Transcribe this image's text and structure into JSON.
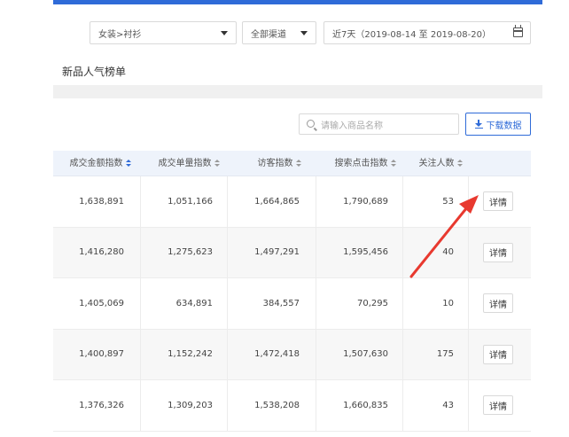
{
  "filters": {
    "category": "女装>衬衫",
    "channel": "全部渠道",
    "date_range": "近7天（2019-08-14 至 2019-08-20）"
  },
  "section_title": "新品人气榜单",
  "search": {
    "placeholder": "请输入商品名称"
  },
  "download_label": "下载数据",
  "table": {
    "headers": [
      "成交金额指数",
      "成交单量指数",
      "访客指数",
      "搜索点击指数",
      "关注人数"
    ],
    "rows": [
      [
        "1,638,891",
        "1,051,166",
        "1,664,865",
        "1,790,689",
        "53"
      ],
      [
        "1,416,280",
        "1,275,623",
        "1,497,291",
        "1,595,456",
        "40"
      ],
      [
        "1,405,069",
        "634,891",
        "384,557",
        "70,295",
        "10"
      ],
      [
        "1,400,897",
        "1,152,242",
        "1,472,418",
        "1,507,630",
        "175"
      ],
      [
        "1,376,326",
        "1,309,203",
        "1,538,208",
        "1,660,835",
        "43"
      ]
    ],
    "detail_label": "详情"
  },
  "colors": {
    "accent": "#2f6bd8",
    "annotation_arrow": "#e8392f"
  }
}
